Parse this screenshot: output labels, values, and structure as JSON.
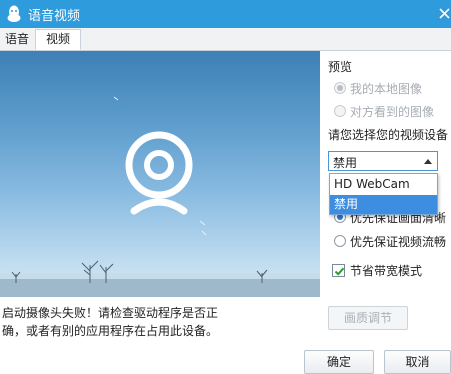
{
  "window": {
    "title": "语音视频",
    "app_icon": "qq-penguin-icon",
    "close_icon": "close-icon"
  },
  "tabs": [
    {
      "label": "语音",
      "selected": false
    },
    {
      "label": "视频",
      "selected": true
    }
  ],
  "preview": {
    "error_message": "启动摄像头失败！请检查驱动程序是否正确，或者有别的应用程序在占用此设备。",
    "error_line1": "启动摄像头失败！请检查驱动程序是否正",
    "error_line2": "确，或者有别的应用程序在占用此设备。",
    "placeholder_icon": "webcam-icon"
  },
  "preview_options": {
    "label": "预览",
    "items": [
      {
        "label": "我的本地图像",
        "checked": true,
        "disabled": true
      },
      {
        "label": "对方看到的图像",
        "checked": false,
        "disabled": true
      }
    ]
  },
  "device": {
    "label": "请您选择您的视频设备",
    "selected": "禁用",
    "options": [
      "HD WebCam",
      "禁用"
    ],
    "highlighted": "禁用"
  },
  "quality": {
    "items": [
      {
        "label": "优先保证画面清晰",
        "checked": true
      },
      {
        "label": "优先保证视频流畅",
        "checked": false
      }
    ]
  },
  "bandwidth": {
    "label": "节省带宽模式",
    "checked": true
  },
  "buttons": {
    "quality_adjust": "画质调节",
    "ok": "确定",
    "cancel": "取消"
  },
  "colors": {
    "titlebar": "#2e9bdc",
    "accent": "#3d8ee0",
    "check_green": "#2d9a3a"
  }
}
